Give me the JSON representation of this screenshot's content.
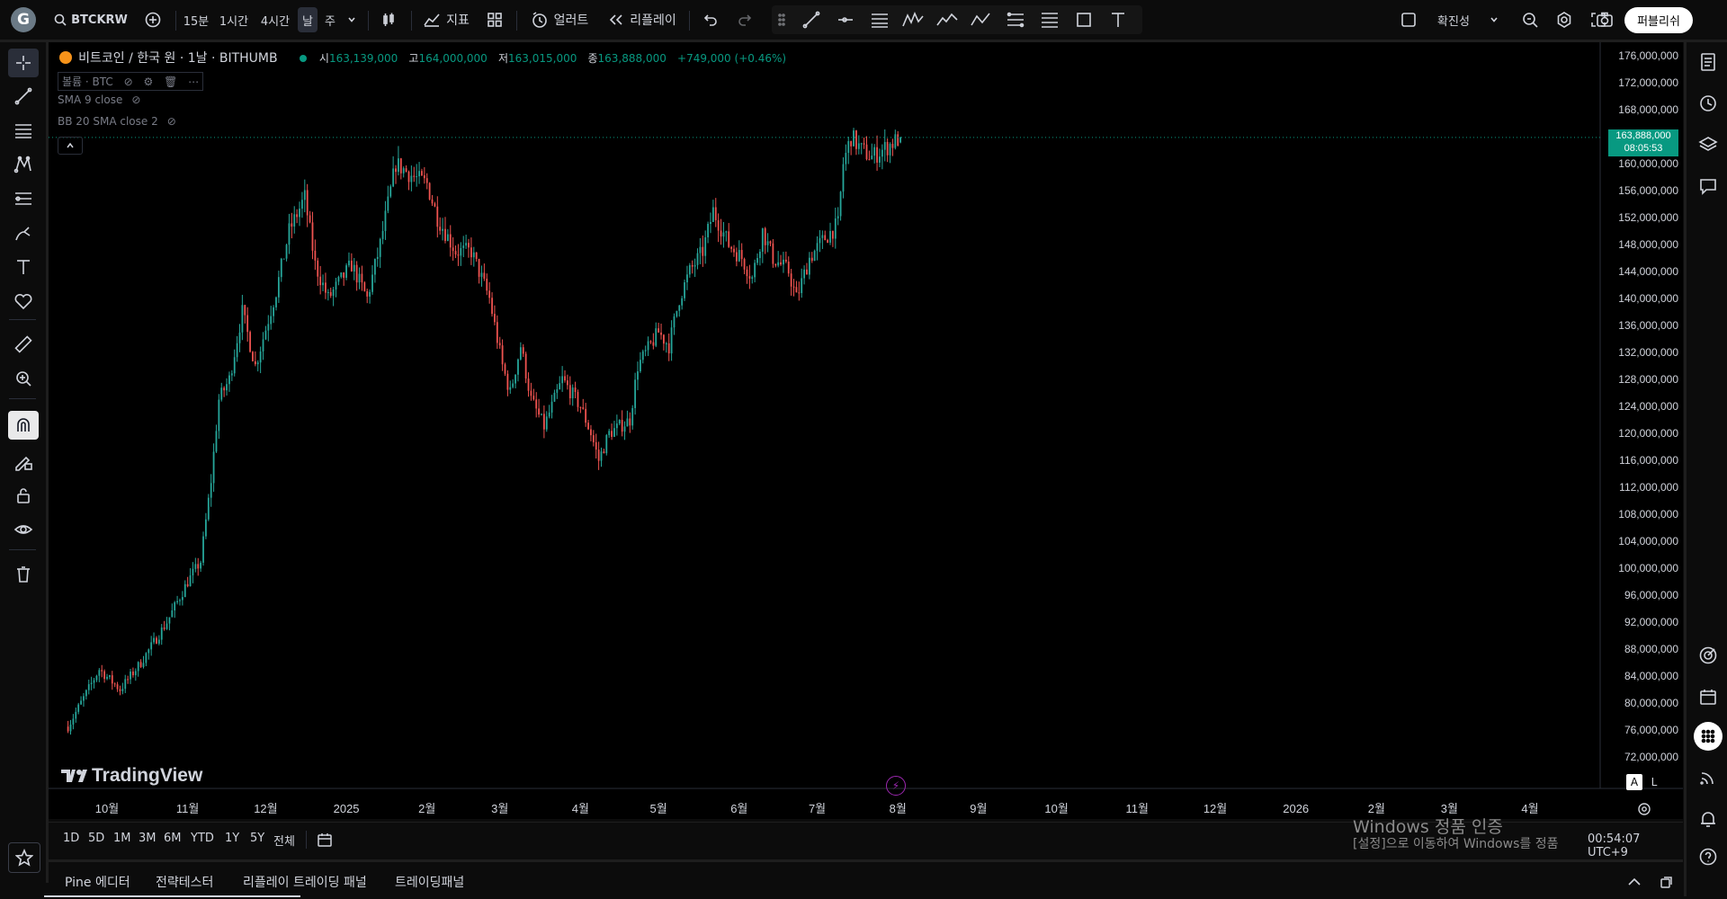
{
  "topbar": {
    "logo_letter": "G",
    "symbol": "BTCKRW",
    "intervals": [
      "15분",
      "1시간",
      "4시간",
      "날",
      "주"
    ],
    "active_interval": "날",
    "indicators_label": "지표",
    "alerts_label": "얼러트",
    "replay_label": "리플레이",
    "layout_name": "확진성",
    "publish_label": "퍼블리쉬"
  },
  "legend": {
    "title": "비트코인 / 한국 원 · 1날 · BITHUMB",
    "open_label": "시",
    "open": "163,139,000",
    "high_label": "고",
    "high": "164,000,000",
    "low_label": "저",
    "low": "163,015,000",
    "close_label": "종",
    "close": "163,888,000",
    "change": "+749,000 (+0.46%)",
    "volume_label": "볼륨 · BTC",
    "sma_label": "SMA 9 close",
    "bb_label": "BB 20 SMA close 2"
  },
  "price_badge": {
    "price": "163,888,000",
    "countdown": "08:05:53",
    "color": "#089981"
  },
  "colors": {
    "up": "#26a69a",
    "down": "#ef5350",
    "background": "#000000"
  },
  "watermark": "TradingView",
  "range_buttons": [
    "1D",
    "5D",
    "1M",
    "3M",
    "6M",
    "YTD",
    "1Y",
    "5Y",
    "전체"
  ],
  "time_display": "00:54:07 UTC+9",
  "windows_notice": {
    "line1": "Windows 정품 인증",
    "line2": "[설정]으로 이동하여 Windows를 정품"
  },
  "panel_tabs": [
    "Pine 에디터",
    "전략테스터",
    "리플레이 트레이딩 패널",
    "트레이딩패널"
  ],
  "scale_buttons": [
    "A",
    "L"
  ],
  "chart_data": {
    "type": "candlestick",
    "title": "비트코인 / 한국 원 · 1날 · BITHUMB",
    "x_ticks": [
      "10월",
      "11월",
      "12월",
      "2025",
      "2월",
      "3월",
      "4월",
      "5월",
      "6월",
      "7월",
      "8월",
      "9월",
      "10월",
      "11월",
      "12월",
      "2026",
      "2월",
      "3월",
      "4월"
    ],
    "y_ticks": [
      "176,000,000",
      "172,000,000",
      "168,000,000",
      "164,000,000",
      "160,000,000",
      "156,000,000",
      "152,000,000",
      "148,000,000",
      "144,000,000",
      "140,000,000",
      "136,000,000",
      "132,000,000",
      "128,000,000",
      "124,000,000",
      "120,000,000",
      "116,000,000",
      "112,000,000",
      "108,000,000",
      "104,000,000",
      "100,000,000",
      "96,000,000",
      "92,000,000",
      "88,000,000",
      "84,000,000",
      "80,000,000",
      "76,000,000",
      "72,000,000"
    ],
    "ylim": [
      70000000,
      178000000
    ],
    "start_date": "2024-09-16",
    "end_date": "2025-08-02",
    "anchors": [
      [
        "2024-09-16",
        76500000
      ],
      [
        "2024-09-28",
        85000000
      ],
      [
        "2024-10-06",
        82000000
      ],
      [
        "2024-10-14",
        86000000
      ],
      [
        "2024-10-24",
        92000000
      ],
      [
        "2024-11-01",
        98000000
      ],
      [
        "2024-11-06",
        101000000
      ],
      [
        "2024-11-10",
        113000000
      ],
      [
        "2024-11-13",
        125000000
      ],
      [
        "2024-11-17",
        128000000
      ],
      [
        "2024-11-22",
        138000000
      ],
      [
        "2024-11-27",
        130000000
      ],
      [
        "2024-12-05",
        141000000
      ],
      [
        "2024-12-10",
        150000000
      ],
      [
        "2024-12-16",
        155000000
      ],
      [
        "2024-12-20",
        145000000
      ],
      [
        "2024-12-25",
        140000000
      ],
      [
        "2025-01-03",
        145000000
      ],
      [
        "2025-01-09",
        140000000
      ],
      [
        "2025-01-14",
        148000000
      ],
      [
        "2025-01-20",
        160000000
      ],
      [
        "2025-01-27",
        158000000
      ],
      [
        "2025-02-01",
        157000000
      ],
      [
        "2025-02-05",
        152000000
      ],
      [
        "2025-02-12",
        147000000
      ],
      [
        "2025-02-18",
        147000000
      ],
      [
        "2025-02-25",
        140000000
      ],
      [
        "2025-03-02",
        130000000
      ],
      [
        "2025-03-05",
        126000000
      ],
      [
        "2025-03-09",
        133000000
      ],
      [
        "2025-03-13",
        125000000
      ],
      [
        "2025-03-18",
        121000000
      ],
      [
        "2025-03-25",
        128000000
      ],
      [
        "2025-04-01",
        124000000
      ],
      [
        "2025-04-05",
        120000000
      ],
      [
        "2025-04-08",
        116000000
      ],
      [
        "2025-04-12",
        120000000
      ],
      [
        "2025-04-20",
        122000000
      ],
      [
        "2025-04-23",
        130000000
      ],
      [
        "2025-05-01",
        135000000
      ],
      [
        "2025-05-05",
        133000000
      ],
      [
        "2025-05-09",
        140000000
      ],
      [
        "2025-05-13",
        144000000
      ],
      [
        "2025-05-18",
        147000000
      ],
      [
        "2025-05-22",
        153000000
      ],
      [
        "2025-05-28",
        148000000
      ],
      [
        "2025-06-02",
        146000000
      ],
      [
        "2025-06-06",
        143000000
      ],
      [
        "2025-06-10",
        150000000
      ],
      [
        "2025-06-14",
        146000000
      ],
      [
        "2025-06-20",
        144000000
      ],
      [
        "2025-06-23",
        140000000
      ],
      [
        "2025-06-28",
        146000000
      ],
      [
        "2025-07-04",
        149000000
      ],
      [
        "2025-07-09",
        151000000
      ],
      [
        "2025-07-11",
        160000000
      ],
      [
        "2025-07-14",
        164000000
      ],
      [
        "2025-07-18",
        162000000
      ],
      [
        "2025-07-22",
        161000000
      ],
      [
        "2025-07-26",
        162000000
      ],
      [
        "2025-08-02",
        163888000
      ]
    ]
  }
}
